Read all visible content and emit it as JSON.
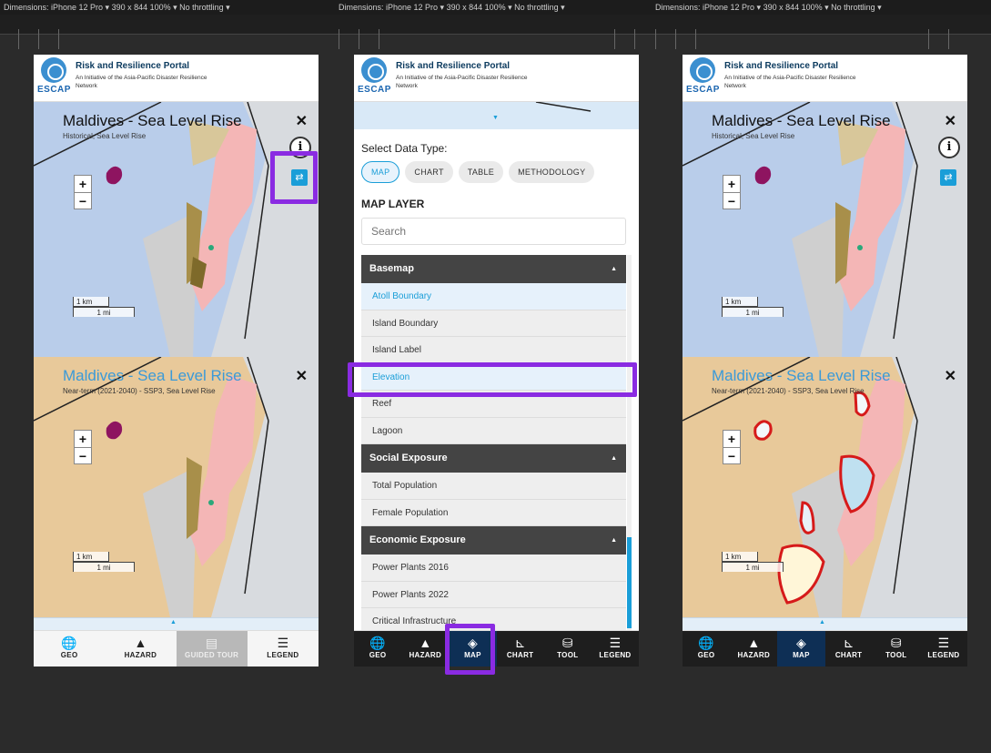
{
  "devtools": {
    "panel_1_text": "Dimensions: iPhone 12 Pro ▾     390   x  844        100% ▾  No throttling ▾",
    "panel_2_text": "Dimensions: iPhone 12 Pro ▾     390   x  844        100% ▾  No throttling ▾",
    "panel_3_text": "Dimensions: iPhone 12 Pro ▾     390   x  844        100% ▾  No throttling ▾"
  },
  "header": {
    "logo_text": "ESCAP",
    "title": "Risk and Resilience Portal",
    "subtitle": "An Initiative of the Asia-Pacific Disaster Resilience Network"
  },
  "left_phone": {
    "map_top": {
      "title": "Maldives - Sea Level Rise",
      "subtitle": "Historical, Sea Level Rise",
      "close": "✕",
      "info": "i",
      "swap": "⇄"
    },
    "map_bottom": {
      "title": "Maldives - Sea Level Rise",
      "subtitle": "Near-term (2021-2040) - SSP3, Sea Level Rise",
      "close": "✕"
    },
    "zoom_in": "+",
    "zoom_out": "−",
    "scale_km": "1 km",
    "scale_mi": "1 mi",
    "nav": [
      {
        "icon": "🌐",
        "label": "GEO"
      },
      {
        "icon": "▲",
        "label": "HAZARD"
      },
      {
        "icon": "▤",
        "label": "GUIDED TOUR"
      },
      {
        "icon": "☰",
        "label": "LEGEND"
      }
    ]
  },
  "middle_phone": {
    "select_label": "Select Data Type:",
    "data_types": [
      "MAP",
      "CHART",
      "TABLE",
      "METHODOLOGY"
    ],
    "map_layer_heading": "MAP LAYER",
    "search_placeholder": "Search",
    "groups": [
      {
        "title": "Basemap",
        "items": [
          "Atoll Boundary",
          "Island Boundary",
          "Island Label",
          "Elevation",
          "Reef",
          "Lagoon"
        ]
      },
      {
        "title": "Social Exposure",
        "items": [
          "Total Population",
          "Female Population"
        ]
      },
      {
        "title": "Economic Exposure",
        "items": [
          "Power Plants 2016",
          "Power Plants 2022",
          "Critical Infrastructure"
        ]
      }
    ],
    "nav": [
      {
        "icon": "🌐",
        "label": "GEO"
      },
      {
        "icon": "▲",
        "label": "HAZARD"
      },
      {
        "icon": "◈",
        "label": "MAP"
      },
      {
        "icon": "⊾",
        "label": "CHART"
      },
      {
        "icon": "⛁",
        "label": "TOOL"
      },
      {
        "icon": "☰",
        "label": "LEGEND"
      }
    ]
  },
  "right_phone": {
    "map_top": {
      "title": "Maldives - Sea Level Rise",
      "subtitle": "Historical, Sea Level Rise",
      "close": "✕",
      "info": "i",
      "swap": "⇄"
    },
    "map_bottom": {
      "title": "Maldives - Sea Level Rise",
      "subtitle": "Near-term (2021-2040) - SSP3, Sea Level Rise",
      "close": "✕"
    },
    "zoom_in": "+",
    "zoom_out": "−",
    "scale_km": "1 km",
    "scale_mi": "1 mi",
    "nav": [
      {
        "icon": "🌐",
        "label": "GEO"
      },
      {
        "icon": "▲",
        "label": "HAZARD"
      },
      {
        "icon": "◈",
        "label": "MAP"
      },
      {
        "icon": "⊾",
        "label": "CHART"
      },
      {
        "icon": "⛁",
        "label": "TOOL"
      },
      {
        "icon": "☰",
        "label": "LEGEND"
      }
    ]
  },
  "colors": {
    "accent": "#1a9ed8",
    "highlight": "#8a2be2",
    "sea_historical": "#b9cdea",
    "land_future": "#e8c99a",
    "island": "#f4b6b6",
    "flood": "#d61a1a"
  }
}
